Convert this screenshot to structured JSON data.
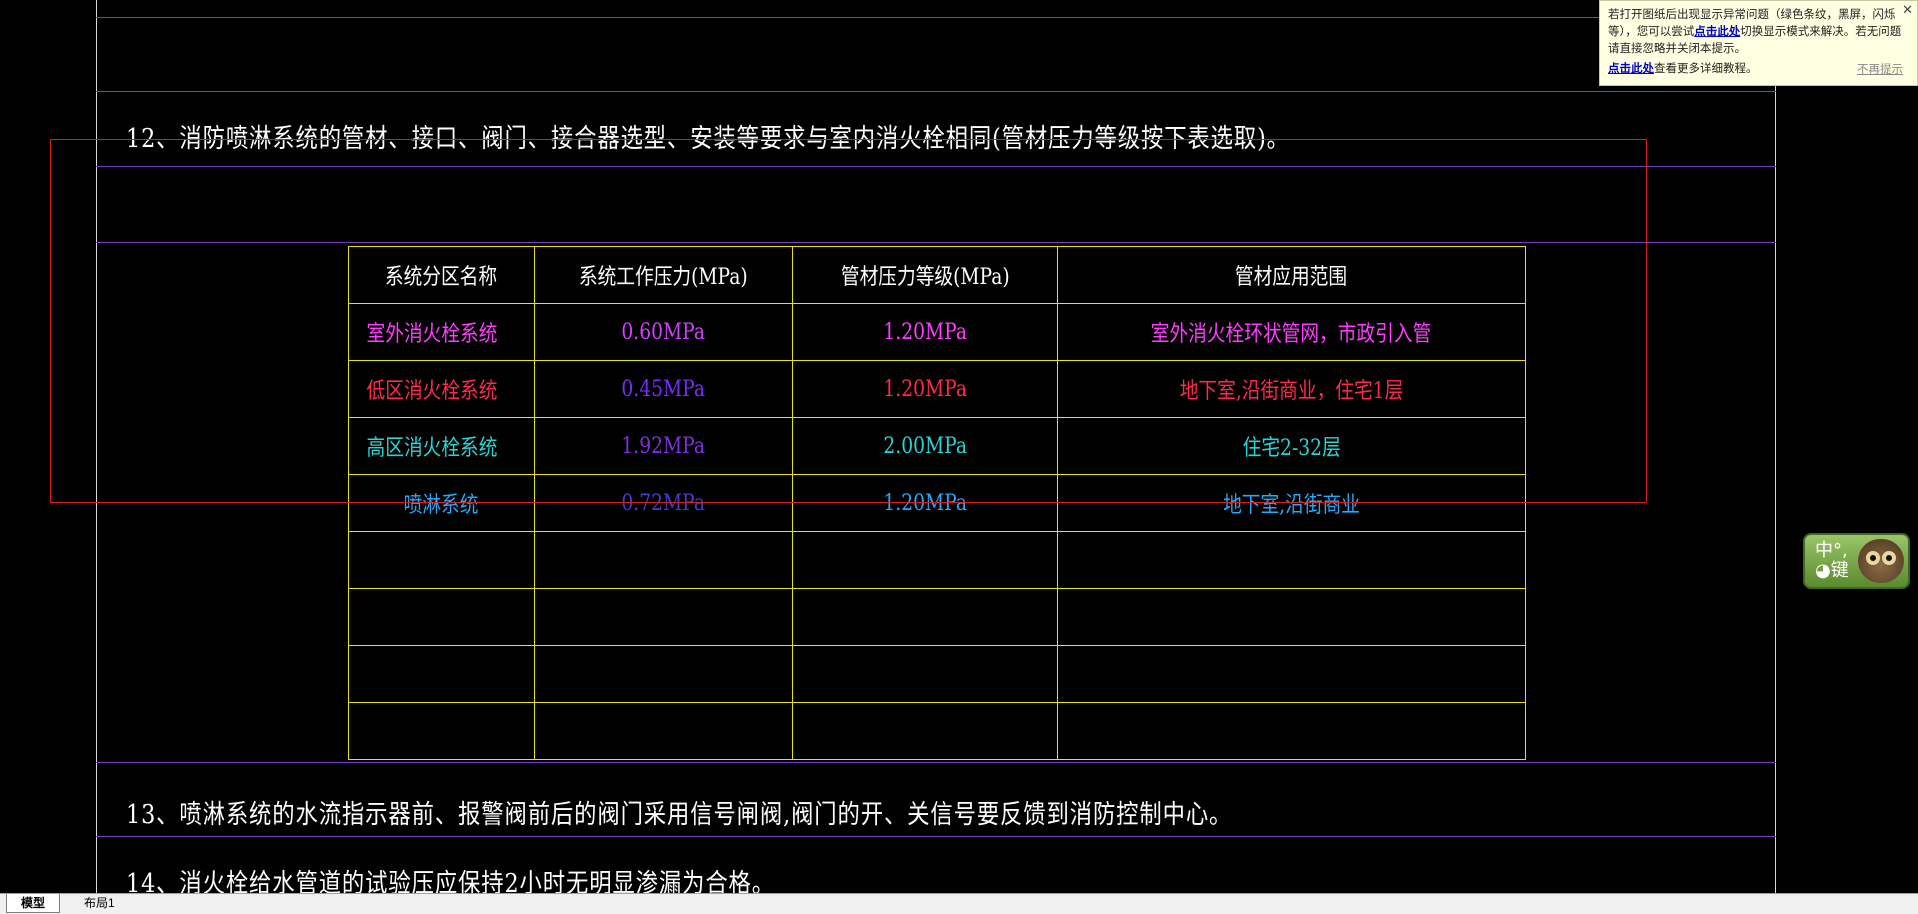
{
  "notes": {
    "note12": "12、消防喷淋系统的管材、接口、阀门、接合器选型、安装等要求与室内消火栓相同(管材压力等级按下表选取)。",
    "note13": "13、喷淋系统的水流指示器前、报警阀前后的阀门采用信号闸阀,阀门的开、关信号要反馈到消防控制中心。",
    "note14": "14、消火栓给水管道的试验压应保持2小时无明显渗漏为合格。"
  },
  "table": {
    "headers": [
      "系统分区名称",
      "系统工作压力(MPa)",
      "管材压力等级(MPa)",
      "管材应用范围"
    ],
    "rows": [
      {
        "name": "室外消火栓系统",
        "work": "0.60MPa",
        "grade": "1.20MPa",
        "scope": "室外消火栓环状管网，市政引入管",
        "colors": [
          "#ff3cff",
          "#d040ff",
          "#ff3cff",
          "#ff3cff"
        ]
      },
      {
        "name": "低区消火栓系统",
        "work": "0.45MPa",
        "grade": "1.20MPa",
        "scope": "地下室,沿街商业，住宅1层",
        "colors": [
          "#ff2a4a",
          "#7a2cff",
          "#ff2a4a",
          "#ff2a4a"
        ]
      },
      {
        "name": "高区消火栓系统",
        "work": "1.92MPa",
        "grade": "2.00MPa",
        "scope": "住宅2-32层",
        "colors": [
          "#2ad4d4",
          "#8030e0",
          "#2ad4d4",
          "#2ad4d4"
        ]
      },
      {
        "name": "喷淋系统",
        "work": "0.72MPa",
        "grade": "1.20MPa",
        "scope": "地下室,沿街商业",
        "colors": [
          "#22aaff",
          "#4040d0",
          "#22aaff",
          "#22aaff"
        ]
      }
    ],
    "header_color": "#ffffff",
    "grid_color": "#e6e600"
  },
  "tip": {
    "line1": "若打开图纸后出现显示异常问题（绿色条纹，黑屏，闪烁等），您可以尝试",
    "link1": "点击此处",
    "line1b": "切换显示模式来解决。若无问题请直接忽略并关闭本提示。",
    "link2": "点击此处",
    "line2": "查看更多详细教程。",
    "nomore": "不再提示",
    "close": "✕"
  },
  "ime": {
    "label_top": "中°,",
    "label_bottom": "◕键"
  },
  "tabs": {
    "model": "模型",
    "layout1": "布局1"
  },
  "colors": {
    "background": "#000000",
    "guide_line": "#7a3fbf",
    "selection_rect": "#d42020"
  }
}
